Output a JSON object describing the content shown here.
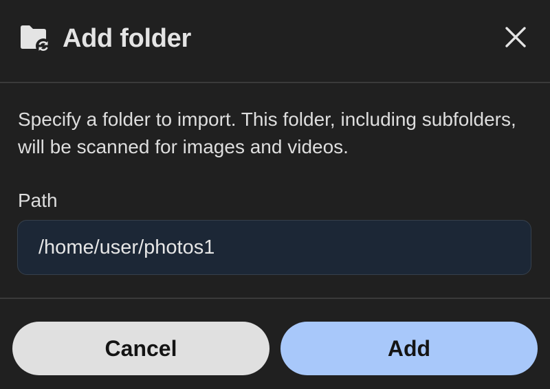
{
  "dialog": {
    "title": "Add folder",
    "header_icon": "folder-sync-icon",
    "close_icon": "close-icon",
    "description": "Specify a folder to import. This folder, including subfolders, will be scanned for images and videos.",
    "path": {
      "label": "Path",
      "value": "/home/user/photos1"
    },
    "buttons": {
      "cancel": "Cancel",
      "add": "Add"
    }
  },
  "colors": {
    "background": "#202020",
    "input_background": "#1c2736",
    "cancel_button": "#e0e0e0",
    "add_button": "#a8c8fa"
  }
}
